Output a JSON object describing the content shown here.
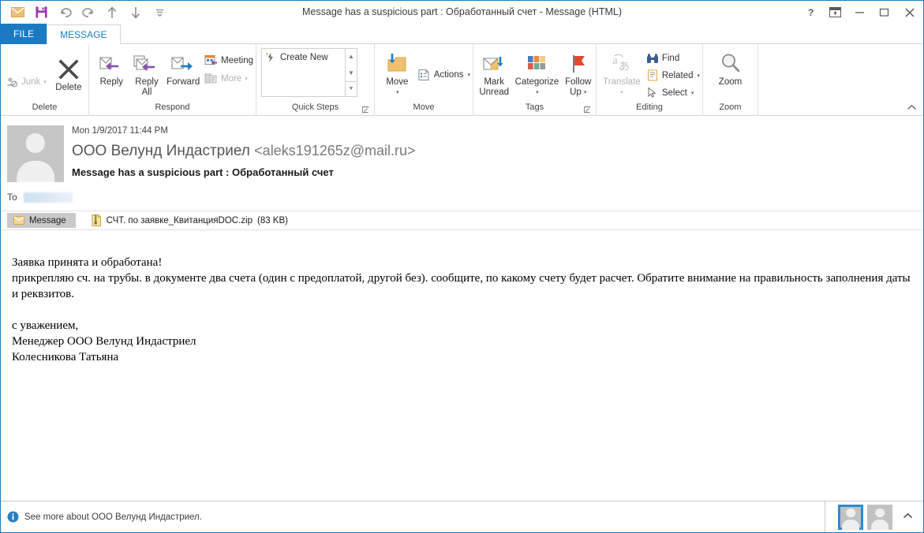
{
  "window": {
    "title": "Message has a suspicious part : Обработанный счет - Message (HTML)",
    "quick_access": [
      {
        "name": "mail-icon",
        "label": "Mail"
      },
      {
        "name": "save-icon",
        "label": "Save"
      },
      {
        "name": "undo-icon",
        "label": "Undo"
      },
      {
        "name": "redo-icon",
        "label": "Redo"
      },
      {
        "name": "previous-item-icon",
        "label": "Previous Item"
      },
      {
        "name": "next-item-icon",
        "label": "Next Item"
      },
      {
        "name": "customize-quick-access-toolbar-icon",
        "label": "Customize Quick Access Toolbar"
      }
    ],
    "controls": {
      "help": "?",
      "ribbon_display_options": "Ribbon Display Options",
      "minimize": "Minimize",
      "maximize": "Maximize",
      "close": "Close"
    }
  },
  "tabs": [
    {
      "label": "FILE",
      "active": false
    },
    {
      "label": "MESSAGE",
      "active": true
    }
  ],
  "ribbon": {
    "groups": [
      {
        "label": "Delete",
        "has_launcher": false
      },
      {
        "label": "Respond",
        "has_launcher": false
      },
      {
        "label": "Quick Steps",
        "has_launcher": true
      },
      {
        "label": "Move",
        "has_launcher": false
      },
      {
        "label": "Tags",
        "has_launcher": true
      },
      {
        "label": "Editing",
        "has_launcher": false
      },
      {
        "label": "Zoom",
        "has_launcher": false
      }
    ],
    "delete": {
      "junk": "Junk",
      "delete": "Delete"
    },
    "respond": {
      "reply": "Reply",
      "reply_all_line1": "Reply",
      "reply_all_line2": "All",
      "forward": "Forward",
      "meeting": "Meeting",
      "more": "More"
    },
    "quick_steps": {
      "create_new": "Create New"
    },
    "move": {
      "move": "Move",
      "actions": "Actions"
    },
    "tags": {
      "mark_unread_line1": "Mark",
      "mark_unread_line2": "Unread",
      "categorize": "Categorize",
      "follow_up_line1": "Follow",
      "follow_up_line2": "Up",
      "category_colors": [
        "#4a7eba",
        "#ed8b3c",
        "#efcd85",
        "#db5b40",
        "#71ab9a",
        "#9a9a9a"
      ]
    },
    "editing": {
      "translate": "Translate",
      "find": "Find",
      "related": "Related",
      "select": "Select"
    },
    "zoom": {
      "zoom": "Zoom"
    },
    "collapse_tooltip": "Collapse the Ribbon"
  },
  "message": {
    "date": "Mon 1/9/2017 11:44 PM",
    "from_name": "ООО Велунд Индастриел",
    "from_address": "<aleks191265z@mail.ru>",
    "subject": "Message has a suspicious part : Обработанный счет",
    "to_label": "To",
    "to_value": "",
    "tabs": {
      "message_tab": "Message"
    },
    "attachment": {
      "name": "СЧТ. по заявке_КвитанцияDOC.zip",
      "size": "(83 KB)"
    },
    "body": {
      "line1": "Заявка принята и обработана!",
      "line2": "прикрепляю сч. на трубы. в документе два счета (один с предоплатой, другой без). сообщите, по какому счету будет расчет. Обратите внимание на правильность заполнения даты и реквзитов.",
      "line3": "с уважением,",
      "line4": "Менеджер ООО Велунд Индастриел",
      "line5": "Колесникова Татьяна"
    }
  },
  "status": {
    "see_more": "See more about ООО Велунд Индастриел."
  },
  "colors": {
    "accent": "#1b7ac2",
    "file_tab": "#1b7ac2",
    "reply_arrow": "#8c4fb0",
    "forward_arrow": "#1f7ec4",
    "folder": "#f0c070",
    "flag": "#e04a2f"
  }
}
